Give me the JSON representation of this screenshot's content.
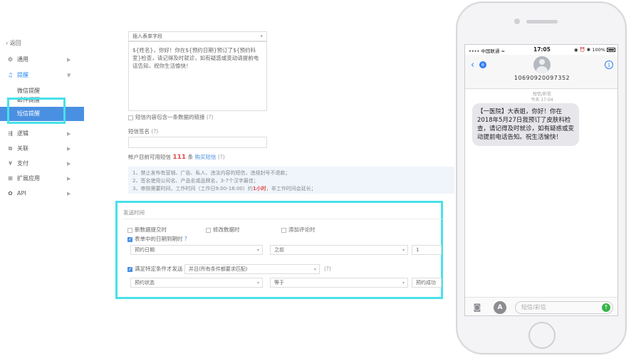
{
  "sidebar": {
    "back": "返回",
    "items": [
      {
        "label": "通用",
        "icon": "gear-icon"
      },
      {
        "label": "提醒",
        "icon": "bell-icon"
      },
      {
        "label": "逻辑",
        "icon": "logic-icon"
      },
      {
        "label": "关联",
        "icon": "link-icon"
      },
      {
        "label": "支付",
        "icon": "payment-icon"
      },
      {
        "label": "扩展应用",
        "icon": "apps-icon"
      },
      {
        "label": "API",
        "icon": "api-icon"
      }
    ],
    "sub_items": [
      {
        "label": "微信提醒"
      },
      {
        "label": "邮件提醒"
      },
      {
        "label": "短信提醒"
      }
    ]
  },
  "form": {
    "field_select_placeholder": "插入表单字段",
    "sms_template": "${姓名}，你好！你在${预约日期}预订了${预约科室}检查，请记得及时就诊，如有疑惑或变动请提前电话告知，祝你生活愉快！",
    "include_link_label": "短信内容包含一条数据的链接",
    "sign_label": "短信签名",
    "remaining_prefix": "帐户目前可用短信",
    "remaining_count": "111",
    "remaining_unit": "条",
    "buy_link": "购买短信",
    "tips": {
      "line1": "1、禁止发布有营销、广告、私人、违法内容的短信，违规封号不退款；",
      "line2": "2、签名使用公司名、产品名或品牌名，3-7个汉字最佳；",
      "line3_prefix": "3、审核需要时间，工作时间（工作日9:00-18:00）约",
      "line3_highlight": "1小时",
      "line3_suffix": "，非工作时间会延长；"
    },
    "send_time": {
      "heading": "发送时间",
      "opt_new_data": "新数据提交时",
      "opt_modify": "修改数据时",
      "opt_comment": "添加评论时",
      "opt_date_field": "表单中的日期到期时",
      "date_field": "预约日期",
      "relation": "之前",
      "amount": "1",
      "opt_condition": "满足特定条件才发送",
      "condition_mode": "并且(所有条件都要求匹配)",
      "cond_field": "预约状态",
      "cond_op": "等于",
      "cond_value": "预约成功"
    }
  },
  "phone": {
    "carrier": "中国联通",
    "time": "17:05",
    "battery": "100%",
    "unread_badge": "6",
    "sender_number": "10690920097352",
    "msg_type": "短信/彩信",
    "msg_time": "今天 17:04",
    "message": "【一医院】大表姐，你好！你在2018年5月27日我预订了皮肤科检查，请记得及时就诊，如有疑惑或变动提前电话告知。祝生活愉快！",
    "input_placeholder": "短信/彩信"
  },
  "colors": {
    "highlight": "#47e1ea",
    "accent": "#4a90e2",
    "ios_blue": "#2e7cf6",
    "send_green": "#38b549"
  }
}
